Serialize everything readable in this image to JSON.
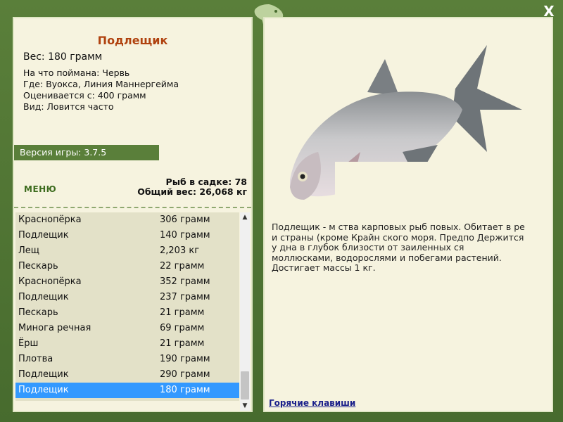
{
  "window": {
    "close_label": "X"
  },
  "fish": {
    "name": "Подлещик",
    "weight": "Вес: 180 грамм",
    "caught_on": "На что поймана: Червь",
    "location": "Где: Вуокса, Линия Маннергейма",
    "value": "Оценивается с: 400 грамм",
    "frequency": "Вид: Ловится часто",
    "description": "Подлещик - м ства карповых рыб повых. Обитает в ре и страны (кроме Крайн ского моря. Предпо Держится у дна в глубок близости от заиленных ся моллюсками, водорослями и побегами растений. Достигает массы 1 кг."
  },
  "game": {
    "version": "Версия игры: 3.7.5"
  },
  "menu": {
    "label": "МЕНЮ"
  },
  "stats": {
    "fish_count": "Рыб в садке: 78",
    "total_weight": "Общий вес: 26,068 кг"
  },
  "catch_list": [
    {
      "name": "Краснопёрка",
      "weight": "306 грамм"
    },
    {
      "name": "Подлещик",
      "weight": "140 грамм"
    },
    {
      "name": "Лещ",
      "weight": "2,203 кг"
    },
    {
      "name": "Пескарь",
      "weight": "22 грамм"
    },
    {
      "name": "Краснопёрка",
      "weight": "352 грамм"
    },
    {
      "name": "Подлещик",
      "weight": "237 грамм"
    },
    {
      "name": "Пескарь",
      "weight": "21 грамм"
    },
    {
      "name": "Минога речная",
      "weight": "69 грамм"
    },
    {
      "name": "Ёрш",
      "weight": "21 грамм"
    },
    {
      "name": "Плотва",
      "weight": "190 грамм"
    },
    {
      "name": "Подлещик",
      "weight": "290 грамм"
    },
    {
      "name": "Подлещик",
      "weight": "180 грамм"
    }
  ],
  "selected_index": 11,
  "links": {
    "hotkeys": "Горячие клавиши"
  },
  "colors": {
    "frame": "#5a7f3a",
    "title": "#b0420f",
    "selection": "#3399ff",
    "link": "#1a1f8a"
  },
  "icons": {
    "close": "close-icon",
    "logo": "fish-logo-icon",
    "scroll_up": "chevron-up-icon",
    "scroll_down": "chevron-down-icon"
  }
}
